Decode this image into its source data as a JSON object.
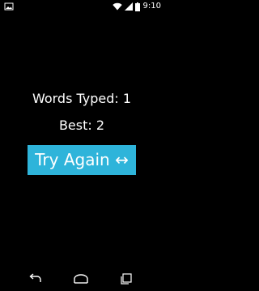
{
  "status_bar": {
    "time": "9:10",
    "icons": [
      "image-notification-icon",
      "wifi-icon",
      "signal-icon",
      "battery-icon"
    ]
  },
  "game": {
    "words_typed": "Words Typed: 1",
    "best": "Best: 2",
    "try_again_label": "Try Again",
    "try_again_symbol": "↔"
  },
  "colors": {
    "background": "#000000",
    "button": "#2eb4da",
    "text": "#ffffff"
  },
  "nav_bar": {
    "icons": [
      "back-icon",
      "home-icon",
      "recents-icon"
    ]
  }
}
